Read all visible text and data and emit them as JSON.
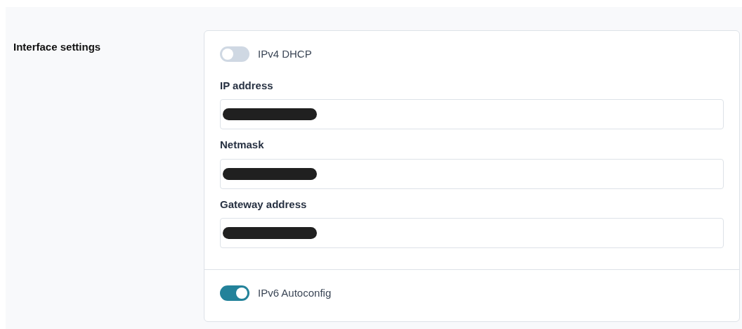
{
  "section": {
    "title": "Interface settings"
  },
  "ipv4_dhcp": {
    "label": "IPv4 DHCP",
    "on": false
  },
  "fields": [
    {
      "label": "IP address",
      "redacted": true
    },
    {
      "label": "Netmask",
      "redacted": true
    },
    {
      "label": "Gateway address",
      "redacted": true
    }
  ],
  "ipv6_autoconfig": {
    "label": "IPv6 Autoconfig",
    "on": true
  }
}
